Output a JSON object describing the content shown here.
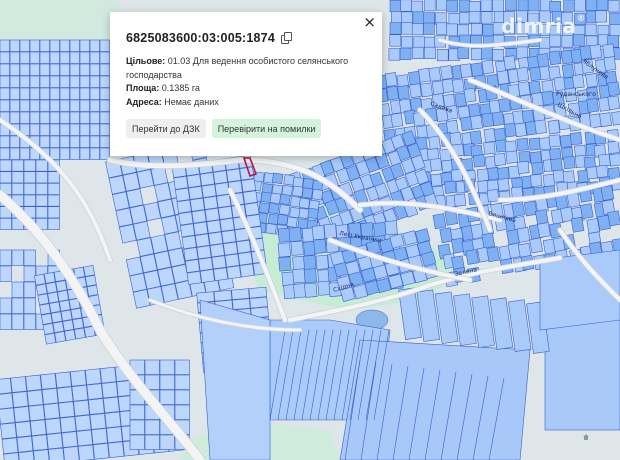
{
  "watermark": {
    "text": "dim",
    "suffix": "ria",
    "reg": "®"
  },
  "popup": {
    "cadastral_number": "6825083600:03:005:1874",
    "purpose_label": "Цільове:",
    "purpose_value": "01.03 Для ведення особистого селянського господарства",
    "area_label": "Площа:",
    "area_value": "0.1385 га",
    "address_label": "Адреса:",
    "address_value": "Немає даних",
    "button_go": "Перейти до ДЗК",
    "button_check": "Перевірити на помилки",
    "close_glyph": "×",
    "icons": {
      "copy": "copy-icon",
      "close": "close-icon"
    }
  },
  "map": {
    "streets": [
      {
        "name": "Лесі Українки"
      },
      {
        "name": "Східна"
      },
      {
        "name": "Зелена"
      },
      {
        "name": "Вишнева"
      },
      {
        "name": "Садова"
      },
      {
        "name": "Шкільна"
      },
      {
        "name": "Яблунева"
      },
      {
        "name": "Руданського"
      }
    ],
    "colors": {
      "background": "#dfe6ea",
      "parcel_fill": "#aacbfa",
      "parcel_stroke": "#3a5fcd",
      "road": "#f4f4f4",
      "green": "#c6ecd6",
      "water": "#8fb8e8",
      "selected_parcel": "#c0143c"
    }
  }
}
